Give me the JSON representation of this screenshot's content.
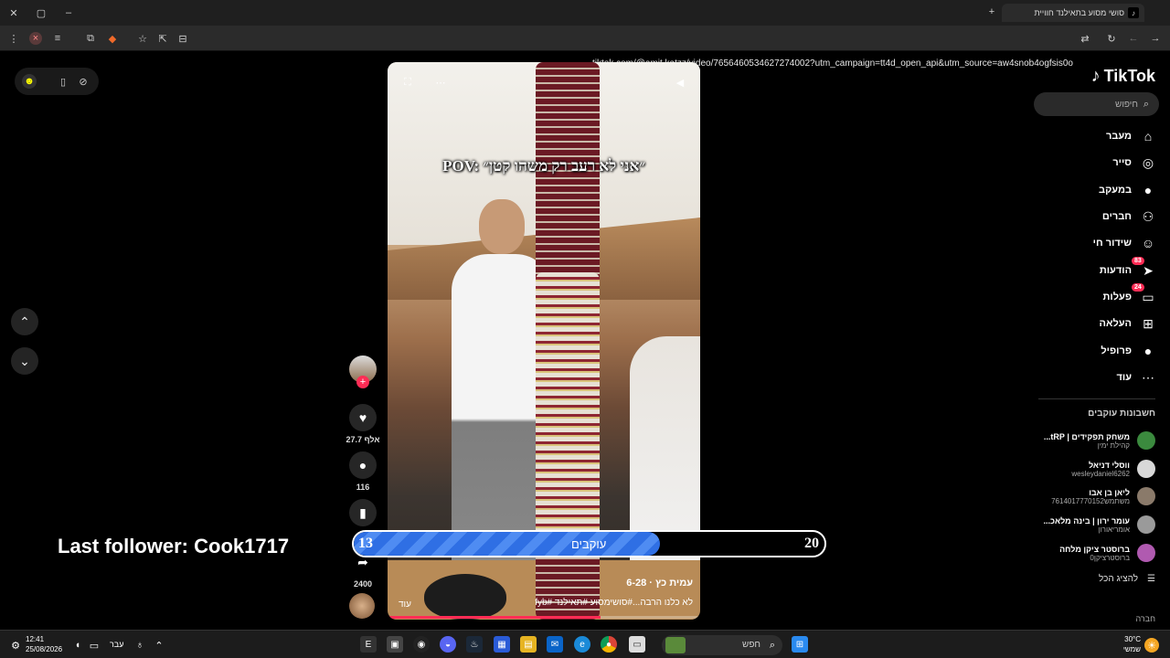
{
  "browser": {
    "tab_title": "סושי מסוע בתאילנד חוויית",
    "url": "tiktok.com/@amit.katzz/video/7656460534627274002?utm_campaign=tt4d_open_api&utm_source=aw4snob4ogfsis0o"
  },
  "overlay": {
    "last_follower": "Last follower: Cook1717",
    "goal_current": "13",
    "goal_target": "20",
    "goal_label": "עוקבים",
    "goal_fraction": 0.65
  },
  "video": {
    "pov_text": "POV: ״אני לא רעב רק משהו קטן״",
    "author": "עמית כץ · 6-28",
    "caption": "לא כלנו הרבה...#סושימסוע #תאילנד #fyb",
    "more": "עוד",
    "progress_fraction": 0.68
  },
  "actions": {
    "likes": "27.7 אלף",
    "comments": "116",
    "shares": "2400"
  },
  "sidebar": {
    "logo": "TikTok",
    "search_placeholder": "חיפוש",
    "nav": [
      {
        "label": "מעבר",
        "icon": "home-icon",
        "glyph": "⌂"
      },
      {
        "label": "סייר",
        "icon": "compass-icon",
        "glyph": "◎"
      },
      {
        "label": "במעקב",
        "icon": "following-avatar-icon",
        "glyph": "●"
      },
      {
        "label": "חברים",
        "icon": "friends-icon",
        "glyph": "⚇"
      },
      {
        "label": "שידור חי",
        "icon": "live-icon",
        "glyph": "☺"
      },
      {
        "label": "הודעות",
        "icon": "messages-icon",
        "glyph": "➤",
        "badge": "83"
      },
      {
        "label": "פעלות",
        "icon": "activity-icon",
        "glyph": "▭",
        "badge": "24"
      },
      {
        "label": "העלאה",
        "icon": "upload-icon",
        "glyph": "⊞"
      },
      {
        "label": "פרופיל",
        "icon": "profile-icon",
        "glyph": "●"
      },
      {
        "label": "עוד",
        "icon": "more-icon",
        "glyph": "⋯"
      }
    ],
    "following_header": "חשבונות עוקבים",
    "accounts": [
      {
        "name": "משחק תפקידים | tRP...",
        "handle": "קהילת ימין",
        "color": "#3b8a3e"
      },
      {
        "name": "ווסלי דניאל",
        "handle": "wesleydaniel6262",
        "color": "#d8d8d8"
      },
      {
        "name": "ליאן בן אבו",
        "handle": "משתמש7614017770152",
        "color": "#8a7a6a"
      },
      {
        "name": "עומר ירון | בינה מלאכ...",
        "handle": "אומריאורון",
        "color": "#9a9a9a"
      },
      {
        "name": "ברוסטר ציקן מלחה",
        "handle": "ברוסטרציקן0",
        "color": "#b05ab0"
      }
    ],
    "show_all": "להציג הכל",
    "company": "חברה"
  },
  "taskbar": {
    "time": "12:41",
    "date": "25/08/2026",
    "lang": "עבר",
    "search": "חפש",
    "temp": "30°C",
    "weather": "שמשי"
  }
}
